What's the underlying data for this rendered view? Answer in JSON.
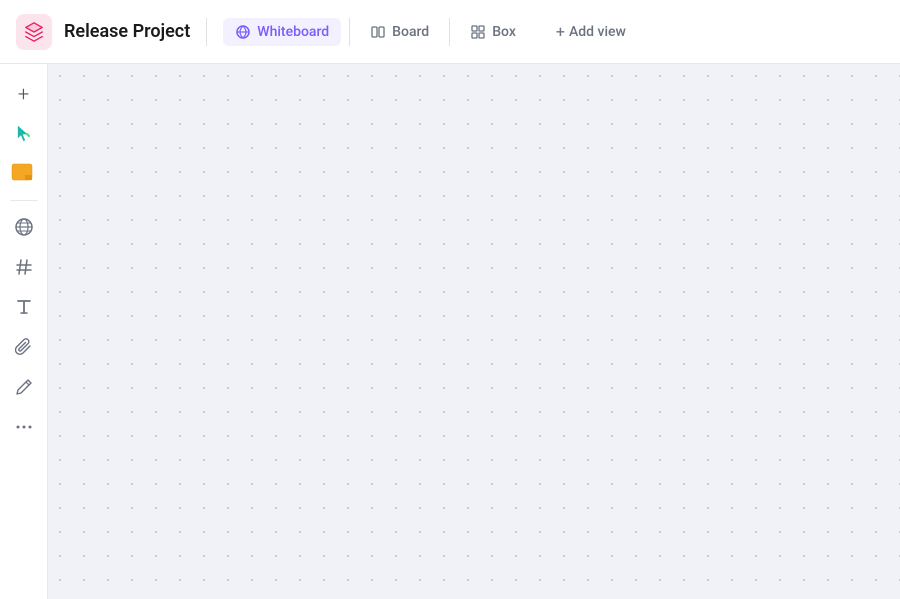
{
  "header": {
    "project_title": "Release Project",
    "tabs": [
      {
        "id": "whiteboard",
        "label": "Whiteboard",
        "active": true
      },
      {
        "id": "board",
        "label": "Board",
        "active": false
      },
      {
        "id": "box",
        "label": "Box",
        "active": false
      }
    ],
    "add_view_label": "Add view"
  },
  "sidebar": {
    "items": [
      {
        "id": "add",
        "icon": "+",
        "label": "Add",
        "interactable": true
      },
      {
        "id": "cursor",
        "icon": "cursor",
        "label": "Cursor tool",
        "interactable": true
      },
      {
        "id": "sticky",
        "icon": "sticky",
        "label": "Sticky note",
        "interactable": true
      },
      {
        "id": "globe",
        "icon": "🌐",
        "label": "Globe",
        "interactable": true
      },
      {
        "id": "hash",
        "icon": "#",
        "label": "Hash",
        "interactable": true
      },
      {
        "id": "text",
        "icon": "T",
        "label": "Text",
        "interactable": true
      },
      {
        "id": "attach",
        "icon": "attach",
        "label": "Attach",
        "interactable": true
      },
      {
        "id": "pen",
        "icon": "pen",
        "label": "Pen",
        "interactable": true
      },
      {
        "id": "more",
        "icon": "...",
        "label": "More options",
        "interactable": true
      }
    ]
  },
  "canvas": {
    "background_color": "#f0f2f7"
  },
  "colors": {
    "active_tab": "#7c5cfc",
    "inactive_tab": "#6b7280",
    "header_bg": "#ffffff",
    "sidebar_bg": "#ffffff",
    "canvas_bg": "#f0f2f7",
    "project_icon_bg": "#fce4ec",
    "project_icon_color": "#e91e63"
  }
}
